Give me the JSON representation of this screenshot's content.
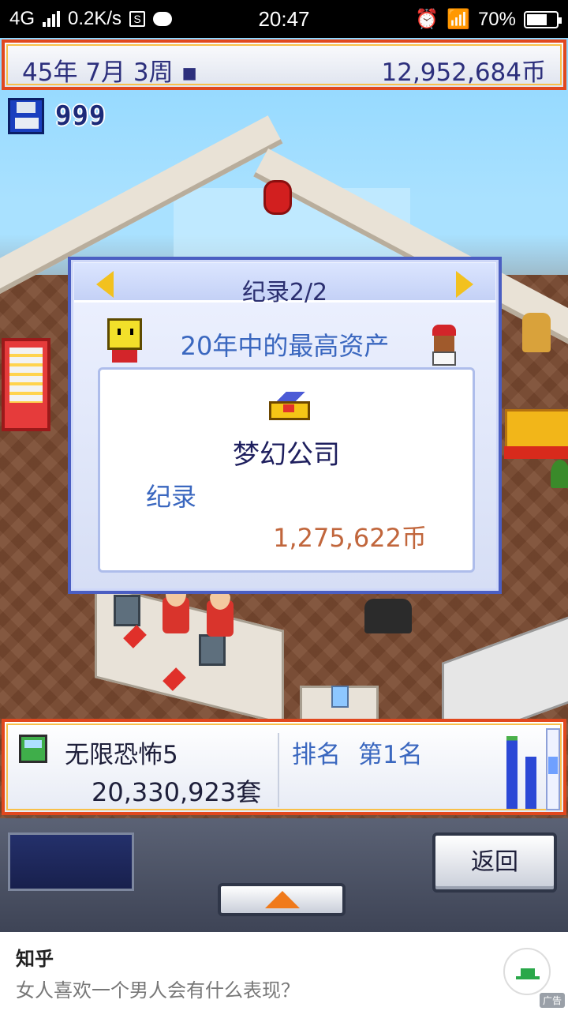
{
  "status_bar": {
    "network": "4G",
    "speed": "0.2K/s",
    "s_badge": "S",
    "time": "20:47",
    "battery": "70%",
    "battery_level": 0.7
  },
  "top_bar": {
    "date": "45年 7月 3周 ▪",
    "money": "12,952,684币"
  },
  "save_count": "999",
  "dialog": {
    "title": "纪录2/2",
    "subtitle": "20年中的最高资产",
    "company": "梦幻公司",
    "record_label": "纪录",
    "record_value": "1,275,622币"
  },
  "info_bar": {
    "game_title": "无限恐怖5",
    "sales": "20,330,923套",
    "rank_label": "排名",
    "rank_value": "第1名",
    "mini_chart": {
      "bars": [
        1.0,
        0.72
      ]
    }
  },
  "controls": {
    "back_label": "返回"
  },
  "ad": {
    "brand": "知乎",
    "text": "女人喜欢一个男人会有什么表现？",
    "tag": "广告"
  },
  "colors": {
    "frame_orange": "#e1481e",
    "title_blue": "#2c2f7c",
    "accent_blue": "#3a67bf",
    "money_orange": "#c1663c"
  }
}
